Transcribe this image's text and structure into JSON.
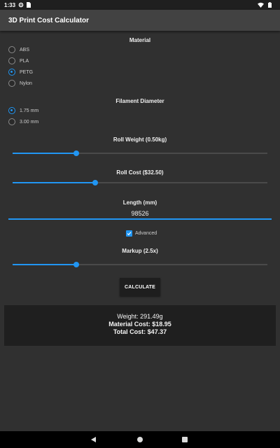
{
  "status_bar": {
    "time": "1:33",
    "icons": [
      "settings-icon",
      "sim-icon",
      "wifi-icon",
      "battery-icon"
    ]
  },
  "app_bar": {
    "title": "3D Print Cost Calculator"
  },
  "material": {
    "title": "Material",
    "options": [
      {
        "label": "ABS",
        "checked": false
      },
      {
        "label": "PLA",
        "checked": false
      },
      {
        "label": "PETG",
        "checked": true
      },
      {
        "label": "Nylon",
        "checked": false
      }
    ]
  },
  "diameter": {
    "title": "Filament Diameter",
    "options": [
      {
        "label": "1.75 mm",
        "checked": true
      },
      {
        "label": "3.00 mm",
        "checked": false
      }
    ]
  },
  "roll_weight": {
    "label": "Roll Weight (0.50kg)",
    "fraction": 0.25
  },
  "roll_cost": {
    "label": "Roll Cost ($32.50)",
    "fraction": 0.325
  },
  "length": {
    "label": "Length (mm)",
    "value": "98526"
  },
  "advanced": {
    "label": "Advanced",
    "checked": true
  },
  "markup": {
    "label": "Markup (2.5x)",
    "fraction": 0.25
  },
  "calculate_button": {
    "label": "CALCULATE"
  },
  "results": {
    "weight": "Weight: 291.49g",
    "material_cost": "Material Cost: $18.95",
    "total_cost": "Total Cost: $47.37"
  },
  "colors": {
    "accent": "#2196f3",
    "background": "#303030",
    "app_bar": "#424242",
    "panel": "#1f1f1f"
  }
}
